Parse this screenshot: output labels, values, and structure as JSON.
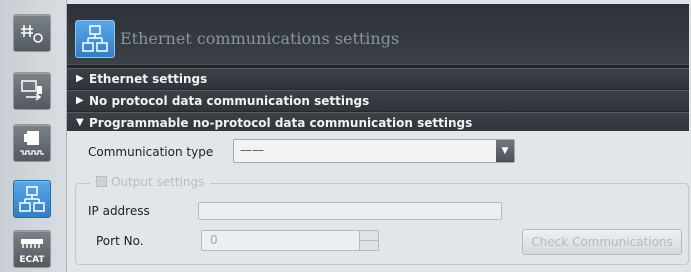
{
  "sidebar": {
    "items": [
      {
        "icon": "network-settings-icon"
      },
      {
        "icon": "data-transfer-icon"
      },
      {
        "icon": "io-module-icon"
      },
      {
        "icon": "network-topology-icon",
        "active": true
      },
      {
        "icon": "ethercat-icon",
        "label": "ECAT"
      }
    ]
  },
  "header": {
    "title": "Ethernet communications settings",
    "icon": "network-topology-icon"
  },
  "sections": [
    {
      "label": "Ethernet settings",
      "expanded": false
    },
    {
      "label": "No protocol data communication settings",
      "expanded": false
    },
    {
      "label": "Programmable no-protocol data communication settings",
      "expanded": true
    }
  ],
  "form": {
    "communication_type_label": "Communication type",
    "communication_type_value": "——",
    "output_settings_label": "Output settings",
    "ip_address_label": "IP address",
    "ip_address_value": "",
    "port_label": "Port No.",
    "port_value": "0",
    "check_button_label": "Check Communications"
  },
  "colors": {
    "accent": "#3a8fd6",
    "header_bg": "#2c3237",
    "body_bg": "#e3e6e9"
  }
}
